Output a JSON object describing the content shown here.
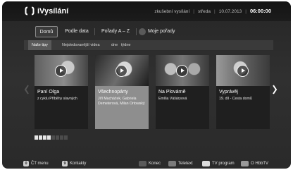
{
  "header": {
    "brand": "iVysílání",
    "status_mode": "zkušební vysílání",
    "day": "středa",
    "date": "10.07.2013",
    "time": "06:00:00"
  },
  "tabs": [
    {
      "label": "Domů",
      "active": true
    },
    {
      "label": "Podle data",
      "active": false
    },
    {
      "label": "Pořady A – Z",
      "active": false
    },
    {
      "label": "Moje pořady",
      "active": false
    }
  ],
  "subtabs": [
    {
      "label": "Naše tipy",
      "active": true
    },
    {
      "label": "Nejsledovanější videa",
      "active": false
    },
    {
      "label": "dne",
      "active": false
    },
    {
      "label": "týdne",
      "active": false
    }
  ],
  "cards": [
    {
      "title": "Paní Olga",
      "subtitle": "z cyklu Příběhy slavných",
      "selected": false
    },
    {
      "title": "Všechnopárty",
      "subtitle": "Jiří Macháček, Gabriela Demeterová, Milan Ortowský",
      "selected": true
    },
    {
      "title": "Na Plovárně",
      "subtitle": "Emília Vášáryová",
      "selected": false
    },
    {
      "title": "Vyprávěj",
      "subtitle": "19. díl - Cesta domů",
      "selected": false
    }
  ],
  "pager": {
    "total": 8,
    "active": 4
  },
  "footer": {
    "menu_key": "0",
    "menu_label": "ČT menu",
    "contacts_key": "9",
    "contacts_label": "Kontakty",
    "colored_keys": [
      {
        "label": "Konec",
        "color": "#5a5a5a"
      },
      {
        "label": "Teletext",
        "color": "#7a7a7a"
      },
      {
        "label": "TV program",
        "color": "#dcdcdc"
      },
      {
        "label": "O HbbTV",
        "color": "#9a9a9a"
      }
    ]
  }
}
